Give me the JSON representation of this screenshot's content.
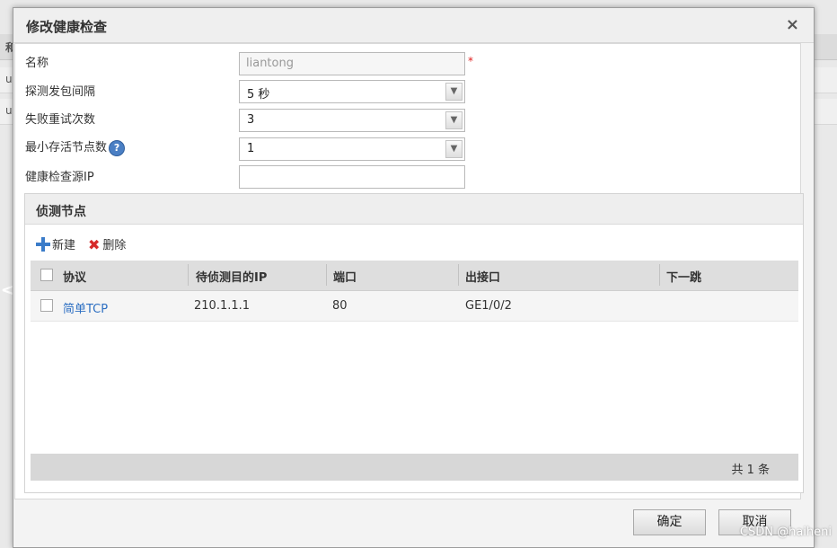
{
  "background": {
    "strip_char": "和",
    "row_chars": [
      "u",
      "u"
    ],
    "nav_arrow": "<"
  },
  "dialog": {
    "title": "修改健康检查",
    "close": "×"
  },
  "form": {
    "name_label": "名称",
    "name_value": "liantong",
    "required_mark": "*",
    "interval_label": "探测发包间隔",
    "interval_value": "5 秒",
    "retry_label": "失败重试次数",
    "retry_value": "3",
    "min_alive_label": "最小存活节点数",
    "help_icon_glyph": "?",
    "min_alive_value": "1",
    "source_ip_label": "健康检查源IP",
    "source_ip_value": ""
  },
  "probe": {
    "title": "侦测节点",
    "new_label": "新建",
    "delete_label": "删除",
    "columns": [
      "协议",
      "待侦测目的IP",
      "端口",
      "出接口",
      "下一跳"
    ],
    "rows": [
      {
        "protocol": "简单TCP",
        "dest_ip": "210.1.1.1",
        "port": "80",
        "out_if": "GE1/0/2",
        "next_hop": ""
      }
    ],
    "footer": "共 1 条"
  },
  "buttons": {
    "ok": "确定",
    "cancel": "取消"
  },
  "watermark": "CSDN @haiheni",
  "colors": {
    "link": "#2d6fc2",
    "required": "#e02020",
    "help_icon": "#4a7fc4",
    "delete_icon": "#d62a2a"
  }
}
